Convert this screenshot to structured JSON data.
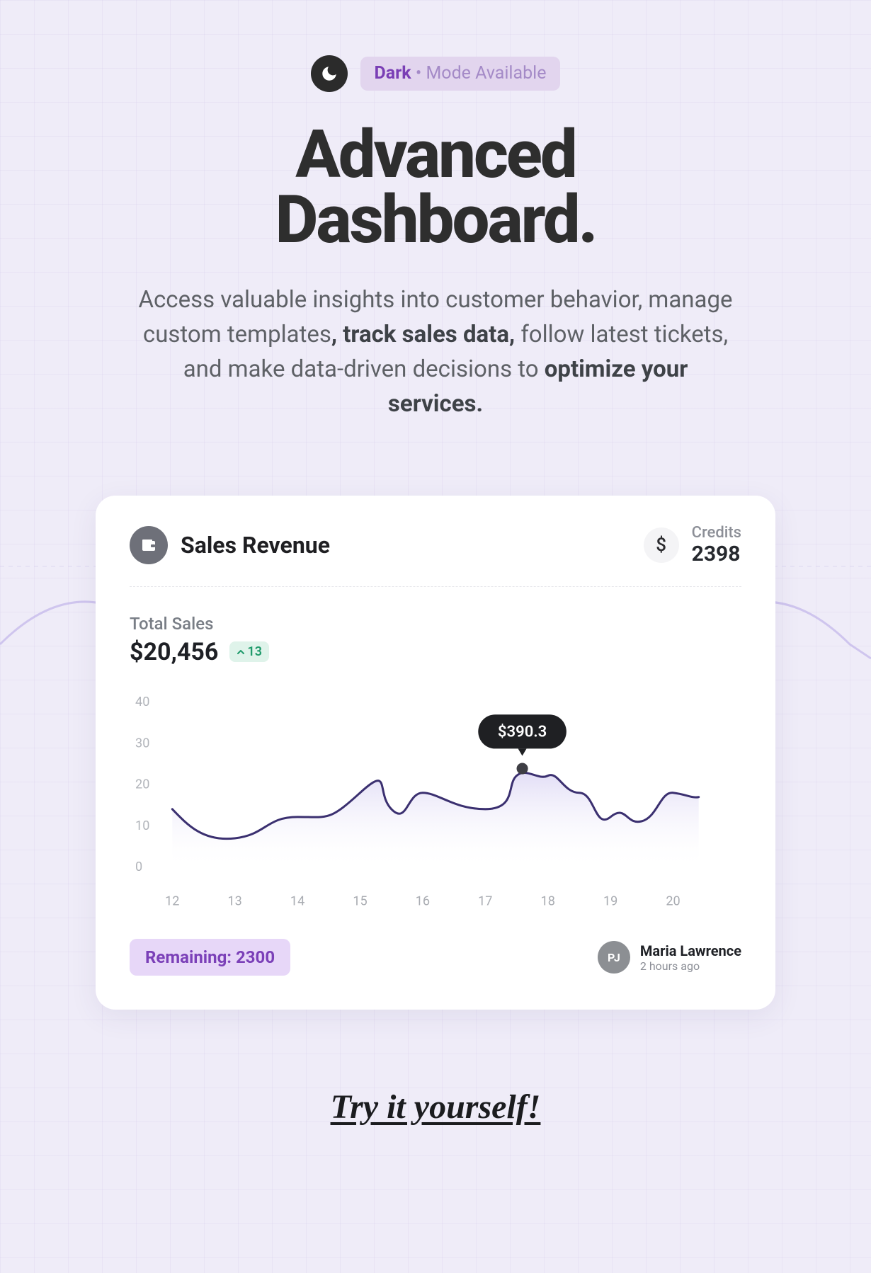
{
  "badge": {
    "strong": "Dark",
    "dot": "•",
    "rest": "Mode Available"
  },
  "hero": {
    "title_line1": "Advanced",
    "title_line2": "Dashboard.",
    "desc_part1": "Access valuable insights into customer behavior, manage custom templates",
    "desc_bold1": ", track sales data,",
    "desc_part2": " follow latest tickets, and make data-driven decisions to ",
    "desc_bold2": "optimize your services."
  },
  "card": {
    "title": "Sales Revenue",
    "credits_label": "Credits",
    "credits_value": "2398",
    "total_label": "Total Sales",
    "total_value": "$20,456",
    "delta_value": "13",
    "remaining_label": "Remaining: 2300",
    "user_initials": "PJ",
    "user_name": "Maria Lawrence",
    "user_time": "2 hours ago",
    "dollar_sign": "$"
  },
  "chart_data": {
    "type": "line",
    "ylabel": "",
    "xlabel": "",
    "ylim": [
      0,
      40
    ],
    "y_ticks": [
      "40",
      "30",
      "20",
      "10",
      "0"
    ],
    "x_ticks": [
      "12",
      "13",
      "14",
      "15",
      "16",
      "17",
      "18",
      "19",
      "20"
    ],
    "tooltip_value": "$390.3",
    "tooltip_index": 12,
    "series": [
      {
        "name": "sales",
        "x": [
          12,
          12.5,
          13,
          13.5,
          14,
          14.5,
          15,
          15.3,
          15.7,
          16,
          16.5,
          17,
          17.5,
          18,
          18.5,
          18.8,
          19,
          19.3,
          19.6,
          20,
          20.2
        ],
        "values": [
          14,
          10,
          7,
          12,
          12,
          11,
          18,
          18,
          14,
          18,
          18,
          14,
          20,
          22,
          21,
          18,
          12,
          15,
          13,
          19,
          18
        ]
      }
    ]
  },
  "cta": "Try it yourself!"
}
